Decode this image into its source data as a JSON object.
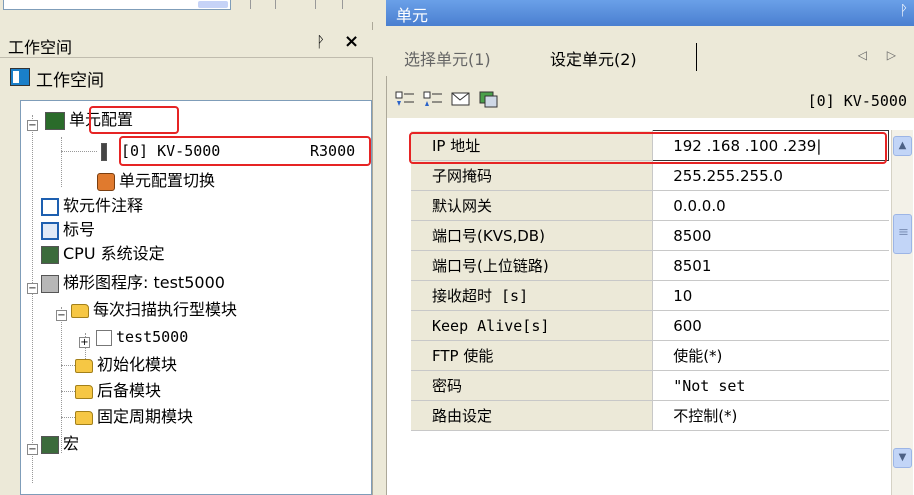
{
  "left_pane": {
    "workspace_title": "工作空间",
    "pin_glyph": "ᚹ",
    "close_glyph": "×",
    "workspace_label": "工作空间",
    "tree": [
      {
        "key": "unit_config",
        "label": "单元配置"
      },
      {
        "key": "unit_item",
        "label": "[0]  KV-5000",
        "right": "R3000"
      },
      {
        "key": "unit_switch",
        "label": "单元配置切换"
      },
      {
        "key": "device_comment",
        "label": "软元件注释"
      },
      {
        "key": "label",
        "label": "标号"
      },
      {
        "key": "cpu_setting",
        "label": "CPU 系统设定"
      },
      {
        "key": "ladder",
        "label": "梯形图程序: test5000"
      },
      {
        "key": "scan_module",
        "label": "每次扫描执行型模块"
      },
      {
        "key": "test5000",
        "label": "test5000"
      },
      {
        "key": "init_module",
        "label": "初始化模块"
      },
      {
        "key": "backup_module",
        "label": "后备模块"
      },
      {
        "key": "fixed_cycle",
        "label": "固定周期模块"
      },
      {
        "key": "macro",
        "label": "宏"
      }
    ]
  },
  "right_pane": {
    "title": "单元",
    "pin_glyph": "ᚹ",
    "tabs": {
      "select_unit": "选择单元(1)",
      "set_unit": "设定单元(2)",
      "nav": "◁ ▷"
    },
    "unit_id": "[0] KV-5000",
    "grid": [
      {
        "name": "IP 地址",
        "value": "192 .168 .100 .239|"
      },
      {
        "name": "子网掩码",
        "value": "255.255.255.0"
      },
      {
        "name": "默认网关",
        "value": "0.0.0.0"
      },
      {
        "name": "端口号(KVS,DB)",
        "value": "8500"
      },
      {
        "name": "端口号(上位链路)",
        "value": "8501"
      },
      {
        "name": "接收超时 [s]",
        "value": "10"
      },
      {
        "name": "Keep Alive[s]",
        "value": "600"
      },
      {
        "name": "FTP 使能",
        "value": "使能(*)"
      },
      {
        "name": "密码",
        "value": "\"Not set"
      },
      {
        "name": "路由设定",
        "value": "不控制(*)"
      }
    ]
  },
  "colors": {
    "highlight": "#e62424",
    "title_bar": "#4a7fd0",
    "panel_bg": "#ece9d8"
  }
}
